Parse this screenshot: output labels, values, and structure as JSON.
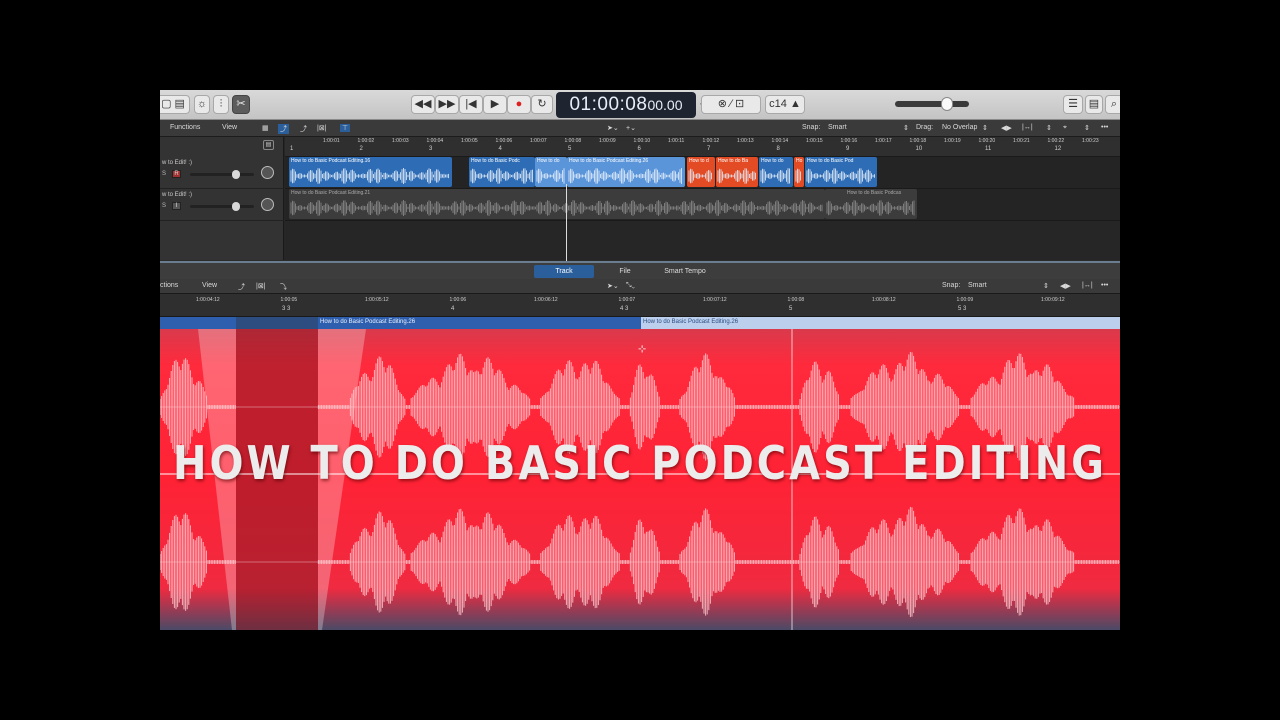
{
  "transport": {
    "time_main": "01:00:08",
    "time_frames": "00.00",
    "key_display": "c14"
  },
  "tracks_header": {
    "functions": "Functions",
    "view": "View",
    "snap_label": "Snap:",
    "snap_value": "Smart",
    "drag_label": "Drag:",
    "drag_value": "No Overlap"
  },
  "ruler_top": {
    "timecodes": [
      "1:00:01",
      "1:00:02",
      "1:00:03",
      "1:00:04",
      "1:00:05",
      "1:00:06",
      "1:00:07",
      "1:00:08",
      "1:00:09",
      "1:00:10",
      "1:00:11",
      "1:00:12",
      "1:00:13",
      "1:00:14",
      "1:00:15",
      "1:00:16",
      "1:00:17",
      "1:00:18",
      "1:00:19",
      "1:00:20",
      "1:00:21",
      "1:00:22",
      "1:00:23"
    ],
    "bars": [
      "1",
      "2",
      "3",
      "4",
      "5",
      "6",
      "7",
      "8",
      "9",
      "10",
      "11",
      "12"
    ]
  },
  "tracks": [
    {
      "name": "w to Edit! :)",
      "mute_solo": "S"
    },
    {
      "name": "w to Edit! :)",
      "mute_solo": "S"
    }
  ],
  "regions": {
    "track1": [
      {
        "name": "How to do Basic Podcast Editing.16",
        "color": "blue"
      },
      {
        "name": "How to do Basic Podc",
        "color": "blue"
      },
      {
        "name": "How to do",
        "color": "blue"
      },
      {
        "name": "How to do Basic Podcast Editing.26",
        "color": "blue-selected"
      },
      {
        "name": "How to d",
        "color": "orange"
      },
      {
        "name": "How to do Ba",
        "color": "orange"
      },
      {
        "name": "How to do",
        "color": "blue"
      },
      {
        "name": "Ho",
        "color": "orange"
      },
      {
        "name": "How to do Basic Pod",
        "color": "blue"
      }
    ],
    "track2": [
      {
        "name": "How to do Basic Podcast Editing.21",
        "color": "gray"
      },
      {
        "name": "How to do Basic Podcas",
        "color": "gray"
      }
    ]
  },
  "tabs": [
    "Track",
    "File",
    "Smart Tempo"
  ],
  "editor_header": {
    "functions": "ctions",
    "view": "View",
    "snap_label": "Snap:",
    "snap_value": "Smart"
  },
  "ruler_editor": {
    "timecodes": [
      "1:00:04:12",
      "1:00:05",
      "1:00:05:12",
      "1:00:06",
      "1:00:06:12",
      "1:00:07",
      "1:00:07:12",
      "1:00:08",
      "1:00:08:12",
      "1:00:09",
      "1:00:09:12"
    ],
    "bars": [
      "3 3",
      "4",
      "4 3",
      "5",
      "5 3"
    ]
  },
  "editor_regions": [
    {
      "name": "How to do Basic Podcast Editing.26"
    },
    {
      "name": "How to do Basic Podcast Editing.26"
    }
  ],
  "overlay_title": "HOW TO DO BASIC PODCAST EDITING",
  "colors": {
    "waveform_red": "#ff2a3c",
    "region_blue": "#2e6db5",
    "region_orange": "#e24b23",
    "lcd_bg": "#1e2430"
  },
  "icons": [
    "rewind-icon",
    "forward-icon",
    "go-to-start-icon",
    "play-icon",
    "record-icon",
    "cycle-icon",
    "pointer-tool-icon",
    "list-editors-icon",
    "browser-icon",
    "search-icon"
  ]
}
